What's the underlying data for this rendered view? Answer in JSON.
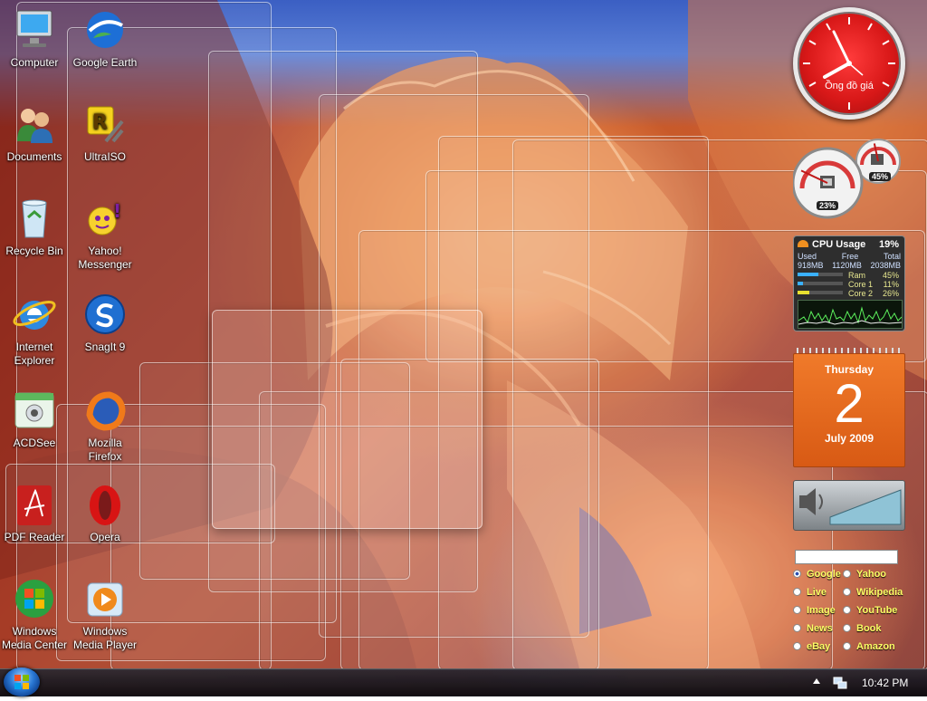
{
  "desktop_icons": [
    {
      "label": "Computer",
      "icon": "computer-icon"
    },
    {
      "label": "Documents",
      "icon": "documents-icon"
    },
    {
      "label": "Recycle Bin",
      "icon": "recycle-bin-icon"
    },
    {
      "label": "Internet Explorer",
      "icon": "internet-explorer-icon"
    },
    {
      "label": "ACDSee",
      "icon": "acdsee-icon"
    },
    {
      "label": "PDF Reader",
      "icon": "pdf-reader-icon"
    },
    {
      "label": "Windows Media Center",
      "icon": "media-center-icon"
    },
    {
      "label": "Google Earth",
      "icon": "google-earth-icon"
    },
    {
      "label": "UltraISO",
      "icon": "ultraiso-icon"
    },
    {
      "label": "Yahoo! Messenger",
      "icon": "yahoo-messenger-icon"
    },
    {
      "label": "SnagIt 9",
      "icon": "snagit-icon"
    },
    {
      "label": "Mozilla Firefox",
      "icon": "firefox-icon"
    },
    {
      "label": "Opera",
      "icon": "opera-icon"
    },
    {
      "label": "Windows Media Player",
      "icon": "media-player-icon"
    }
  ],
  "clock_gadget": {
    "caption": "Ồng đồ giá"
  },
  "meters_gadget": {
    "cpu_percent": 23,
    "cpu_label": "23%",
    "ram_percent": 45,
    "ram_label": "45%"
  },
  "cpu_usage_gadget": {
    "title": "CPU Usage",
    "percent_label": "19%",
    "headers": [
      "Used",
      "Free",
      "Total"
    ],
    "memory": [
      "918MB",
      "1120MB",
      "2038MB"
    ],
    "rows": [
      {
        "label": "Ram",
        "value": "45%",
        "fraction": 0.45
      },
      {
        "label": "Core 1",
        "value": "11%",
        "fraction": 0.11
      },
      {
        "label": "Core 2",
        "value": "26%",
        "fraction": 0.26
      }
    ]
  },
  "calendar_gadget": {
    "weekday": "Thursday",
    "day": "2",
    "month_year": "July 2009"
  },
  "search_gadget": {
    "options": [
      "Google",
      "Yahoo",
      "Live",
      "Wikipedia",
      "Image",
      "YouTube",
      "News",
      "Book",
      "eBay",
      "Amazon"
    ],
    "selected": "Google"
  },
  "taskbar": {
    "time": "10:42 PM"
  },
  "colors": {
    "calendar_orange": "#e8641e",
    "clock_red": "#d81818",
    "gadget_text_yellow": "#ffff66"
  }
}
